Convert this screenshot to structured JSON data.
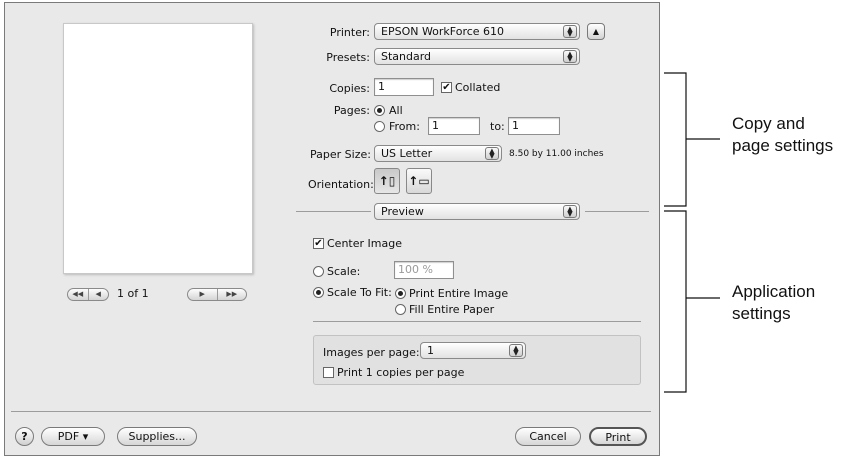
{
  "printer": {
    "label": "Printer:",
    "value": "EPSON WorkForce 610"
  },
  "presets": {
    "label": "Presets:",
    "value": "Standard"
  },
  "copies": {
    "label": "Copies:",
    "value": "1",
    "collated_label": "Collated",
    "collated": true
  },
  "pages": {
    "label": "Pages:",
    "all_label": "All",
    "from_label": "From:",
    "from_value": "1",
    "to_label": "to:",
    "to_value": "1"
  },
  "paper_size": {
    "label": "Paper Size:",
    "value": "US Letter",
    "dimensions": "8.50 by 11.00 inches"
  },
  "orientation": {
    "label": "Orientation:"
  },
  "section_popup": {
    "value": "Preview"
  },
  "preview_nav": {
    "page_count": "1 of 1"
  },
  "app_settings": {
    "center_image_label": "Center Image",
    "scale_label": "Scale:",
    "scale_value": "100 %",
    "scale_to_fit_label": "Scale To Fit:",
    "print_entire_image_label": "Print Entire Image",
    "fill_entire_paper_label": "Fill Entire Paper",
    "images_per_page_label": "Images per page:",
    "images_per_page_value": "1",
    "copies_per_page_label": "Print 1 copies per page"
  },
  "footer": {
    "help": "?",
    "pdf_label": "PDF ▾",
    "supplies_label": "Supplies...",
    "cancel_label": "Cancel",
    "print_label": "Print"
  },
  "annotations": {
    "copy_page_line1": "Copy and",
    "copy_page_line2": "page settings",
    "application_line1": "Application",
    "application_line2": "settings"
  }
}
